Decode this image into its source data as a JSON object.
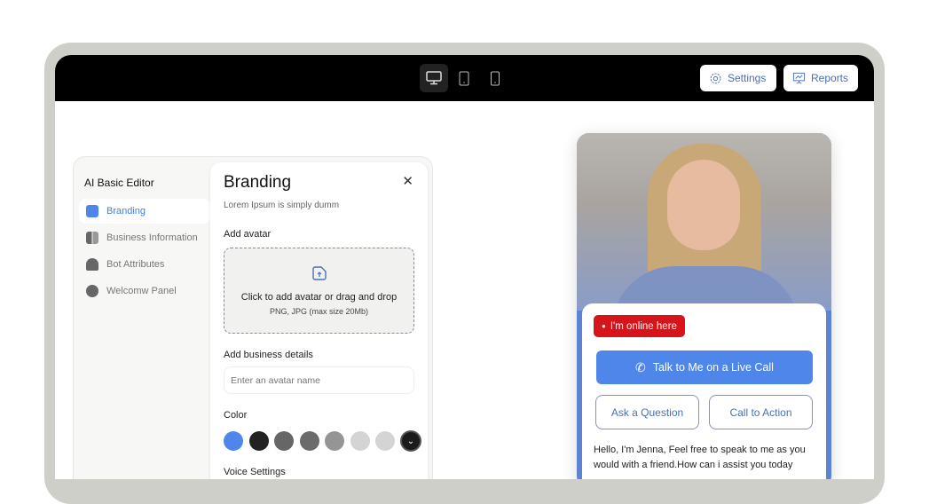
{
  "toolbar": {
    "devices": [
      {
        "icon": "desktop-icon",
        "active": true
      },
      {
        "icon": "tablet-icon",
        "active": false
      },
      {
        "icon": "mobile-icon",
        "active": false
      }
    ],
    "settings_label": "Settings",
    "reports_label": "Reports"
  },
  "editor": {
    "title": "AI Basic Editor",
    "sidebar": {
      "items": [
        {
          "label": "Branding",
          "icon": "document-icon",
          "active": true
        },
        {
          "label": "Business Information",
          "icon": "grid-list-icon",
          "active": false
        },
        {
          "label": "Bot Attributes",
          "icon": "bot-icon",
          "active": false
        },
        {
          "label": "Welcomw Panel",
          "icon": "gear-icon",
          "active": false
        }
      ]
    },
    "panel": {
      "title": "Branding",
      "subtitle": "Lorem Ipsum is simply dumm",
      "avatar_label": "Add avatar",
      "upload_text": "Click to add avatar or drag and drop",
      "upload_hint": "PNG, JPG (max size 20Mb)",
      "business_label": "Add business details",
      "business_placeholder": "Enter an avatar name",
      "color_label": "Color",
      "colors": [
        "#4f86ea",
        "#222222",
        "#666666",
        "#6b6b6b",
        "#959595",
        "#d4d4d4",
        "#d4d4d4"
      ],
      "voice_label": "Voice Settings"
    }
  },
  "preview": {
    "status": "I'm online here",
    "live_call": "Talk to Me on a Live Call",
    "ask": "Ask a Question",
    "cta": "Call to Action",
    "message": "Hello, I'm Jenna, Feel free to speak to me as you would with a friend.How can i assist you today",
    "accent": "#4f86ea",
    "status_color": "#d6141a"
  }
}
